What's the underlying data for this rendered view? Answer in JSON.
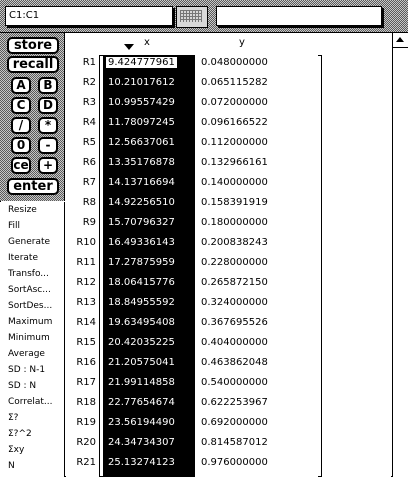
{
  "cell_reference": "C1:C1",
  "entry_value": "",
  "panel_buttons": {
    "store": "store",
    "recall": "recall",
    "a": "A",
    "b": "B",
    "c": "C",
    "d": "D",
    "divide": "/",
    "multiply": "*",
    "zero": "0",
    "minus": "-",
    "ce": "ce",
    "plus": "+",
    "enter": "enter"
  },
  "functions": [
    "Resize",
    "Fill",
    "Generate",
    "Iterate",
    "Transfo...",
    "SortAsc...",
    "SortDes...",
    "Maximum",
    "Minimum",
    "Average",
    "SD : N-1",
    "SD : N",
    "Correlat...",
    "Σ?",
    "Σ?^2",
    "Σxy",
    "N"
  ],
  "columns": {
    "x": "x",
    "y": "y"
  },
  "rows": [
    {
      "label": "R1",
      "x": "9.424777961",
      "y": "0.048000000"
    },
    {
      "label": "R2",
      "x": "10.21017612",
      "y": "0.065115282"
    },
    {
      "label": "R3",
      "x": "10.99557429",
      "y": "0.072000000"
    },
    {
      "label": "R4",
      "x": "11.78097245",
      "y": "0.096166522"
    },
    {
      "label": "R5",
      "x": "12.56637061",
      "y": "0.112000000"
    },
    {
      "label": "R6",
      "x": "13.35176878",
      "y": "0.132966161"
    },
    {
      "label": "R7",
      "x": "14.13716694",
      "y": "0.140000000"
    },
    {
      "label": "R8",
      "x": "14.92256510",
      "y": "0.158391919"
    },
    {
      "label": "R9",
      "x": "15.70796327",
      "y": "0.180000000"
    },
    {
      "label": "R10",
      "x": "16.49336143",
      "y": "0.200838243"
    },
    {
      "label": "R11",
      "x": "17.27875959",
      "y": "0.228000000"
    },
    {
      "label": "R12",
      "x": "18.06415776",
      "y": "0.265872150"
    },
    {
      "label": "R13",
      "x": "18.84955592",
      "y": "0.324000000"
    },
    {
      "label": "R14",
      "x": "19.63495408",
      "y": "0.367695526"
    },
    {
      "label": "R15",
      "x": "20.42035225",
      "y": "0.404000000"
    },
    {
      "label": "R16",
      "x": "21.20575041",
      "y": "0.463862048"
    },
    {
      "label": "R17",
      "x": "21.99114858",
      "y": "0.540000000"
    },
    {
      "label": "R18",
      "x": "22.77654674",
      "y": "0.622253967"
    },
    {
      "label": "R19",
      "x": "23.56194490",
      "y": "0.692000000"
    },
    {
      "label": "R20",
      "x": "24.34734307",
      "y": "0.814587012"
    },
    {
      "label": "R21",
      "x": "25.13274123",
      "y": "0.976000000"
    }
  ]
}
